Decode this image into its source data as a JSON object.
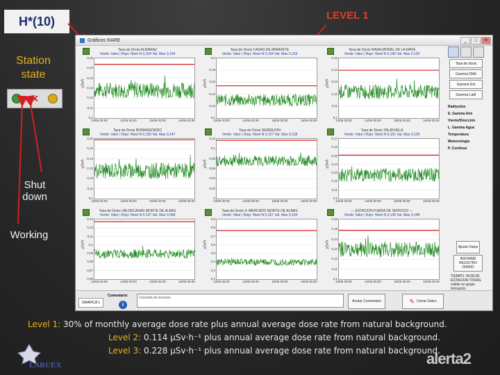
{
  "labels": {
    "h_label": "H*(10)",
    "level": "LEVEL 1",
    "station_state": "Station state",
    "shut_down": "Shut down",
    "working": "Working"
  },
  "window": {
    "title": "Gráficos RARE",
    "controls": [
      "_",
      "□",
      "×"
    ]
  },
  "charts": [
    {
      "title": "Tasa de Dosis ALMARAZ",
      "subtitle": "Verde: Valor | Rojo: Nivel N 0,154 Val. Max 0,154",
      "yunit": "µSv/h",
      "yticks": [
        "0,16",
        "0,15",
        "0,14",
        "0,13",
        "0,12",
        "0,11",
        "0,1"
      ],
      "xticks": [
        "13/06 00:00",
        "14/06 00:00",
        "15/06 00:00",
        "16/06 00:00"
      ],
      "level": 0.154,
      "ymin": 0.1,
      "ymax": 0.16,
      "base": 0.128,
      "noise": 0.008
    },
    {
      "title": "Tasa de Dosis CASAS DE MIRAVETE",
      "subtitle": "Verde: Valor | Rojo: Nivel N 0,154 Val. Max 0,153",
      "yunit": "µSv/h",
      "yticks": [
        "0,2",
        "0,18",
        "0,16",
        "0,14",
        "0,12",
        "0,1"
      ],
      "xticks": [
        "13/06 00:00",
        "14/06 00:00",
        "15/06 00:00",
        "16/06 00:00"
      ],
      "level": 0.154,
      "ymin": 0.1,
      "ymax": 0.2,
      "base": 0.13,
      "noise": 0.01
    },
    {
      "title": "Tasa de Dosis NAVALMORAL DE LA MATA",
      "subtitle": "Verde: Valor | Rojo: Nivel N 0,140 Val. Max 0,130",
      "yunit": "µSv/h",
      "yticks": [
        "0,15",
        "0,14",
        "0,13",
        "0,12",
        "0,11",
        "0,1"
      ],
      "xticks": [
        "13/06 00:00",
        "14/06 00:00",
        "15/06 00:00",
        "16/06 00:00"
      ],
      "level": 0.14,
      "ymin": 0.1,
      "ymax": 0.15,
      "base": 0.122,
      "noise": 0.006
    },
    {
      "title": "Tasa de Dosis ROMANGORDO",
      "subtitle": "Verde: Valor | Rojo: Nivel N 0,159 Val. Max 0,147",
      "yunit": "µSv/h",
      "yticks": [
        "0,16",
        "0,15",
        "0,14",
        "0,13",
        "0,12",
        "0,11",
        "0,1"
      ],
      "xticks": [
        "13/06 00:00",
        "14/06 00:00",
        "15/06 00:00",
        "16/06 00:00"
      ],
      "level": 0.159,
      "ymin": 0.1,
      "ymax": 0.16,
      "base": 0.128,
      "noise": 0.008
    },
    {
      "title": "Tasa de Dosis SERREJON",
      "subtitle": "Verde: Valor | Rojo: Nivel N 0,127 Val. Max 0,118",
      "yunit": "µSv/h",
      "yticks": [
        "0,12",
        "0,1",
        "0,08",
        "0,06",
        "0,04",
        "0,02",
        "0"
      ],
      "xticks": [
        "13/06 00:00",
        "14/06 00:00",
        "15/06 00:00",
        "16/06 00:00"
      ],
      "level": 0.127,
      "ymin": 0,
      "ymax": 0.13,
      "base": 0.082,
      "noise": 0.012
    },
    {
      "title": "Tasa de Dosis TALAYUELA",
      "subtitle": "Verde: Valor | Rojo: Nivel N 0,151 Val. Max 0,129",
      "yunit": "µSv/h",
      "yticks": [
        "0,17",
        "0,16",
        "0,15",
        "0,14",
        "0,13",
        "0,12",
        "0,11",
        "0,1"
      ],
      "xticks": [
        "13/06 00:00",
        "14/06 00:00",
        "15/06 00:00",
        "16/06 00:00"
      ],
      "level": 0.151,
      "ymin": 0.1,
      "ymax": 0.17,
      "base": 0.128,
      "noise": 0.008
    },
    {
      "title": "Tasa de Dosis VALDECAÑAS MONTE DE ALBAS",
      "subtitle": "Verde: Valor | Rojo: Nivel N 0,137 Val. Max 0,098",
      "yunit": "µSv/h",
      "yticks": [
        "0,13",
        "0,12",
        "0,11",
        "0,1",
        "0,09",
        "0,08",
        "0,07",
        "0,06"
      ],
      "xticks": [
        "13/06 00:00",
        "14/06 00:00",
        "15/06 00:00",
        "16/06 00:00"
      ],
      "level": 0.137,
      "ymin": 0.06,
      "ymax": 0.14,
      "base": 0.094,
      "noise": 0.006
    },
    {
      "title": "Tasa de Dosis 4: MERCADO MONTE DE ALBAS",
      "subtitle": "Verde: Valor | Rojo: Nivel N 0,167 Val. Max 0,154",
      "yunit": "µSv/h",
      "yticks": [
        "0,9",
        "0,8",
        "0,7",
        "0,6",
        "0,5",
        "0,4",
        "0,3",
        "0,2"
      ],
      "xticks": [
        "13/06 00:00",
        "14/06 00:00",
        "15/06 00:00",
        "16/06 00:00"
      ],
      "level": 0.77,
      "ymin": 0.2,
      "ymax": 0.9,
      "base": 0.4,
      "noise": 0.04
    },
    {
      "title": "--- ESTACION FUERA DE SERVICIO ---",
      "subtitle": "Verde: Valor | Rojo: Nivel N 0,149 Val. Max 0,148",
      "yunit": "µSv/h",
      "yticks": [
        "0,16",
        "0,15",
        "0,14",
        "0,13",
        "0,12",
        "0,11",
        "0,1"
      ],
      "xticks": [
        "13/06 00:00",
        "14/06 00:00",
        "15/06 00:00",
        "16/06 00:00"
      ],
      "level": 0.149,
      "ymin": 0.1,
      "ymax": 0.16,
      "base": 0.13,
      "noise": 0.008
    }
  ],
  "side_panel": {
    "buttons": [
      "Tasa de dosis",
      "Gamma DNA",
      "Gamma Est",
      "Gamma LaM"
    ],
    "list": [
      "Radiyodos",
      "E. Gamma Aire",
      "Viento/Dirección",
      "L. Gamma Agua",
      "Temperatura",
      "Meteorología",
      "P. Continua"
    ],
    "small_buttons": [
      "Ajuste Datos",
      "INFORME REGISTRO DIARIO"
    ],
    "note": "TIEMPO: 00:00:00 ESTACION TODAS visible en grupo formación"
  },
  "bottom_bar": {
    "tab": "GRAFICA 1",
    "comment_label": "Comentario:",
    "comment_placeholder": "Consulta de lecturas",
    "save_comment": "Anotar Comentario",
    "exit_button": "Cerrar Datos"
  },
  "caption": {
    "line1_label": "Level 1:",
    "line1_text": " 30% of monthly average dose rate plus annual average dose rate from natural background.",
    "line2_label": "Level 2:",
    "line2_text": " 0.114 µSv·h⁻¹ plus annual average dose rate from natural background.",
    "line3_label": "Level 3:",
    "line3_text": " 0.228 µSv·h⁻¹ plus annual average dose rate from natural background."
  },
  "logos": {
    "left": "LARUEX",
    "right": "alerta2"
  },
  "colors": {
    "label_yellow": "#e8b21a",
    "level_red": "#e03c30",
    "trace_green": "#1f8a1f",
    "threshold_red": "#d42020"
  }
}
